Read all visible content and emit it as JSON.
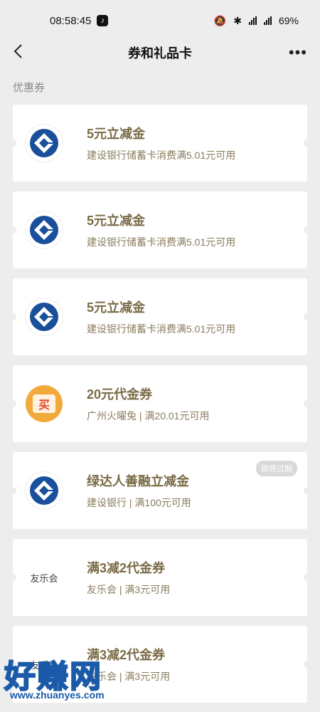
{
  "status": {
    "time": "08:58:45",
    "battery": "69%"
  },
  "nav": {
    "back_icon": "chevron-left-icon",
    "title": "券和礼品卡",
    "more": "•••"
  },
  "section": {
    "label": "优惠券"
  },
  "coupons": [
    {
      "logo": "ccb",
      "title": "5元立减金",
      "desc": "建设银行储蓄卡消费满5.01元可用"
    },
    {
      "logo": "ccb",
      "title": "5元立减金",
      "desc": "建设银行储蓄卡消费满5.01元可用"
    },
    {
      "logo": "ccb",
      "title": "5元立减金",
      "desc": "建设银行储蓄卡消费满5.01元可用"
    },
    {
      "logo": "buy",
      "logo_text": "买",
      "title": "20元代金券",
      "desc": "广州火曜兔 | 满20.01元可用"
    },
    {
      "logo": "ccb",
      "title": "绿达人善融立减金",
      "desc": "建设银行 | 满100元可用",
      "badge": "即将过期"
    },
    {
      "logo": "text",
      "logo_text": "友乐会",
      "title": "满3减2代金券",
      "desc": "友乐会 | 满3元可用"
    },
    {
      "logo": "text",
      "logo_text": "友乐会",
      "title": "满3减2代金券",
      "desc": "友乐会 | 满3元可用"
    }
  ],
  "watermark": {
    "big": "好赚网",
    "url": "www.zhuanyes.com"
  },
  "colors": {
    "ccb_blue": "#1a4f9c",
    "title_gold": "#7a6a46"
  }
}
